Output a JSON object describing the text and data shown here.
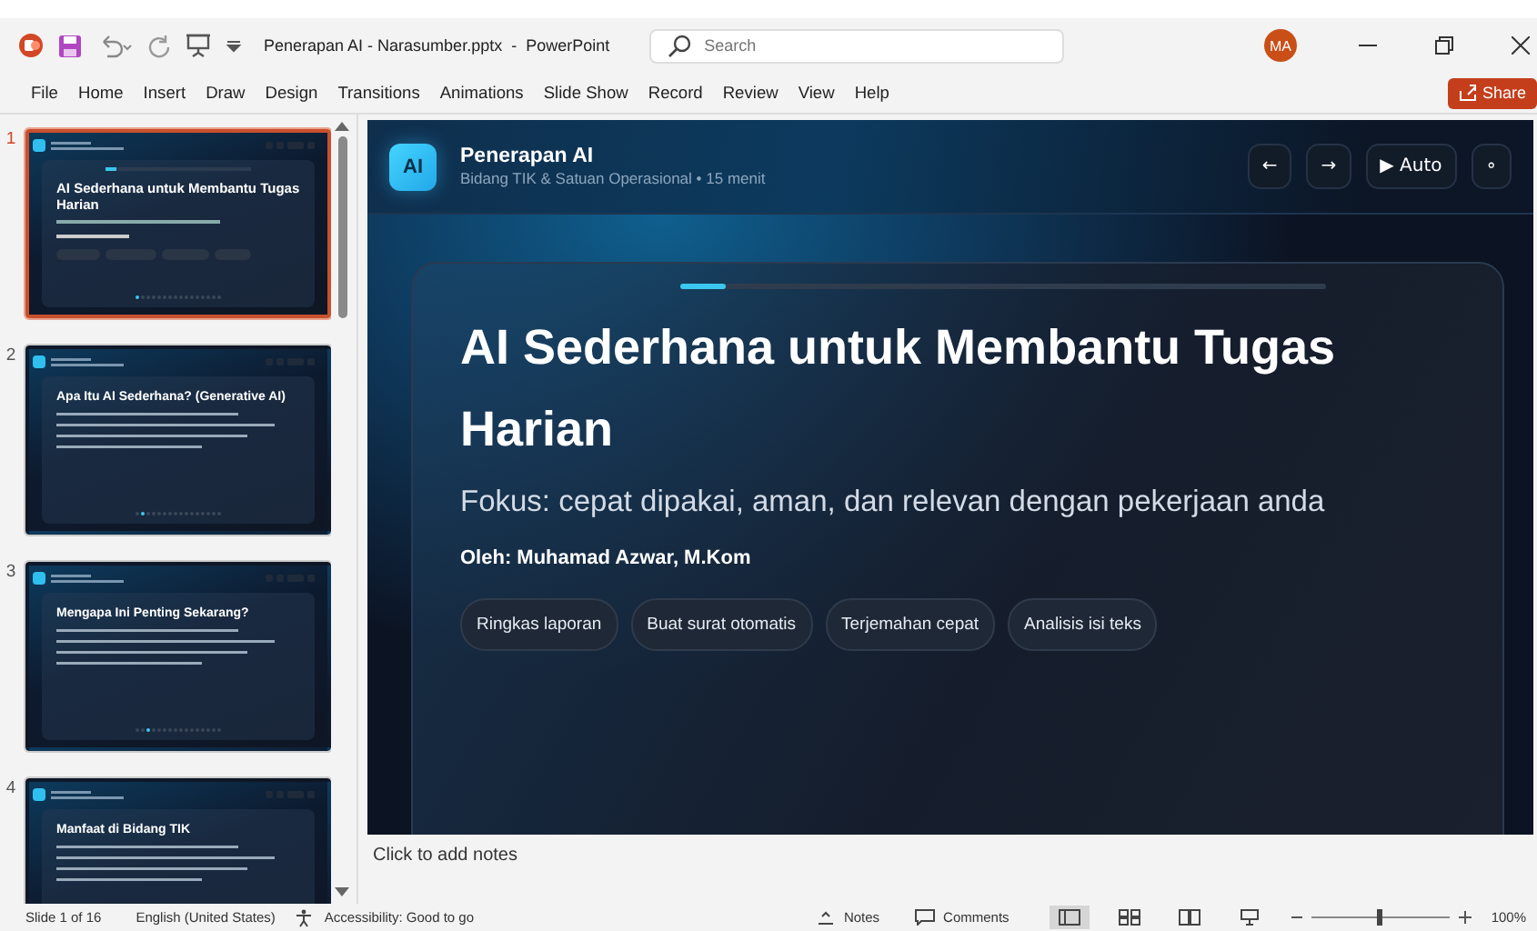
{
  "app": {
    "title": "Penerapan AI - Narasumber.pptx  -  PowerPoint",
    "search_placeholder": "Search",
    "user_initials": "MA"
  },
  "ribbon_tabs": [
    "File",
    "Home",
    "Insert",
    "Draw",
    "Design",
    "Transitions",
    "Animations",
    "Slide Show",
    "Record",
    "Review",
    "View",
    "Help"
  ],
  "share": "Share",
  "slides": [
    {
      "number": "1",
      "selected": true,
      "kind": "title",
      "title": "AI Sederhana untuk Membantu Tugas Harian"
    },
    {
      "number": "2",
      "selected": false,
      "kind": "bullets",
      "title": "Apa Itu AI Sederhana? (Generative AI)"
    },
    {
      "number": "3",
      "selected": false,
      "kind": "bullets",
      "title": "Mengapa Ini Penting Sekarang?"
    },
    {
      "number": "4",
      "selected": false,
      "kind": "bullets",
      "title": "Manfaat di Bidang TIK"
    }
  ],
  "slide": {
    "logo": "AI",
    "deck_title": "Penerapan AI",
    "deck_subtitle": "Bidang TIK & Satuan Operasional • 15 menit",
    "controls": [
      "←",
      "→",
      "▶ Auto",
      "∘"
    ],
    "progress": {
      "level": 0.07
    },
    "title": "AI Sederhana untuk Membantu Tugas Harian",
    "subtitle": "Fokus: cepat dipakai, aman, dan relevan dengan pekerjaan anda",
    "author": "Oleh: Muhamad Azwar, M.Kom",
    "chips": [
      "Ringkas laporan",
      "Buat surat otomatis",
      "Terjemahan cepat",
      "Analisis isi teks"
    ]
  },
  "notes_placeholder": "Click to add notes",
  "status": {
    "slide_count": "Slide 1 of 16",
    "language": "English (United States)",
    "accessibility": "Accessibility: Good to go",
    "notes": "Notes",
    "comments": "Comments",
    "zoom": {
      "level": 0.5
    },
    "zoom_reading": "100%",
    "views": [
      {
        "kind": "normal",
        "selected": true
      },
      {
        "kind": "sorter",
        "selected": false
      },
      {
        "kind": "reading",
        "selected": false
      },
      {
        "kind": "presenter",
        "selected": false
      }
    ]
  }
}
